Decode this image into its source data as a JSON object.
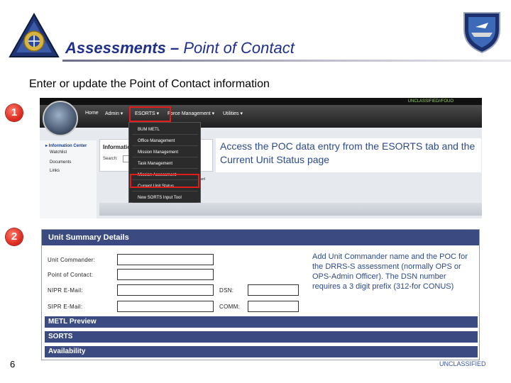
{
  "slide": {
    "title_bold": "Assessments –",
    "title_rest": " Point of Contact",
    "subtitle": "Enter or update the Point of Contact information",
    "page_number": "6",
    "classification": "UNCLASSIFIED"
  },
  "steps": [
    "1",
    "2"
  ],
  "colors": {
    "title": "#1f2f8c",
    "highlight": "#e21b1b",
    "form_header": "#3b4a80",
    "callout": "#2c4a8a"
  },
  "step1": {
    "banner": "UNCLASSIFIED//FOUO",
    "nav": [
      "Home",
      "Admin ▾",
      "ESORTS ▾",
      "Force Management ▾",
      "Utilities ▾"
    ],
    "dropdown_items": [
      "BUM METL",
      "Office Management",
      "Mission Management",
      "Task Management",
      "Mission Assessment",
      "Current Unit Status",
      "New SORTS Input Tool"
    ],
    "left_panel": [
      "▸ Information Center",
      "Watchlist",
      "Documents",
      "Links"
    ],
    "info_title": "Information",
    "search_label": "Search:",
    "behind_text": "enerl",
    "callout": "Access the POC data entry from the ESORTS tab and the Current Unit Status page"
  },
  "step2": {
    "header": "Unit Summary Details",
    "labels": {
      "unit_commander": "Unit Commander:",
      "point_of_contact": "Point of Contact:",
      "nipr": "NIPR E-Mail:",
      "sipr": "SIPR E-Mail:",
      "dsn": "DSN:",
      "comm": "COMM:"
    },
    "values": {
      "unit_commander": "",
      "point_of_contact": "",
      "nipr": "",
      "sipr": "",
      "dsn": "",
      "comm": ""
    },
    "sections": [
      "METL Preview",
      "SORTS",
      "Availability"
    ],
    "callout": "Add Unit Commander name and the POC for the DRRS-S assessment (normally OPS or OPS-Admin Officer). The DSN number requires a 3 digit prefix (312-for CONUS)"
  },
  "icons": [
    "navy-seal-logo",
    "naval-aviation-emblem",
    "drrs-seal-icon",
    "dropdown-caret-icon"
  ]
}
